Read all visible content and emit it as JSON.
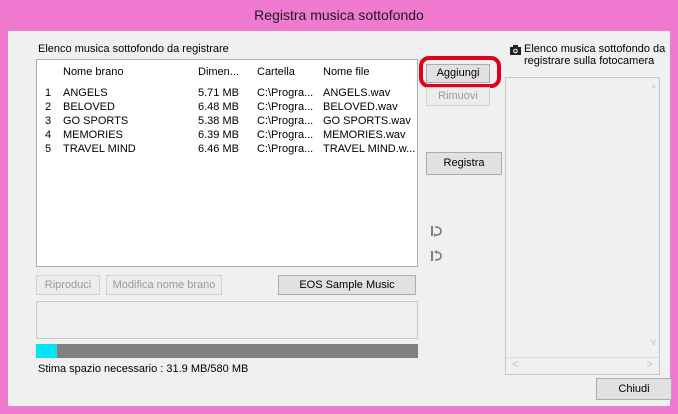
{
  "window": {
    "title": "Registra musica sottofondo"
  },
  "left_panel": {
    "heading": "Elenco musica sottofondo da registrare",
    "columns": [
      "Nome brano",
      "Dimen...",
      "Cartella",
      "Nome file"
    ],
    "rows": [
      {
        "n": "1",
        "name": "ANGELS",
        "size": "5.71 MB",
        "folder": "C:\\Progra...",
        "file": "ANGELS.wav"
      },
      {
        "n": "2",
        "name": "BELOVED",
        "size": "6.48 MB",
        "folder": "C:\\Progra...",
        "file": "BELOVED.wav"
      },
      {
        "n": "3",
        "name": "GO SPORTS",
        "size": "5.38 MB",
        "folder": "C:\\Progra...",
        "file": "GO SPORTS.wav"
      },
      {
        "n": "4",
        "name": "MEMORIES",
        "size": "6.39 MB",
        "folder": "C:\\Progra...",
        "file": "MEMORIES.wav"
      },
      {
        "n": "5",
        "name": "TRAVEL MIND",
        "size": "6.46 MB",
        "folder": "C:\\Progra...",
        "file": "TRAVEL MIND.w..."
      }
    ],
    "play_label": "Riproduci",
    "rename_label": "Modifica nome brano",
    "sample_label": "EOS Sample Music",
    "space_text": "Stima spazio necessario : 31.9 MB/580 MB",
    "space_fraction": 0.055
  },
  "middle": {
    "add_label": "Aggiungi",
    "remove_label": "Rimuovi",
    "register_label": "Registra"
  },
  "right_panel": {
    "heading": "Elenco musica sottofondo da registrare sulla fotocamera"
  },
  "close_label": "Chiudi",
  "colors": {
    "highlight": "#e0001b",
    "progress_fill": "#00e5f2",
    "frame": "#f07ad0"
  }
}
